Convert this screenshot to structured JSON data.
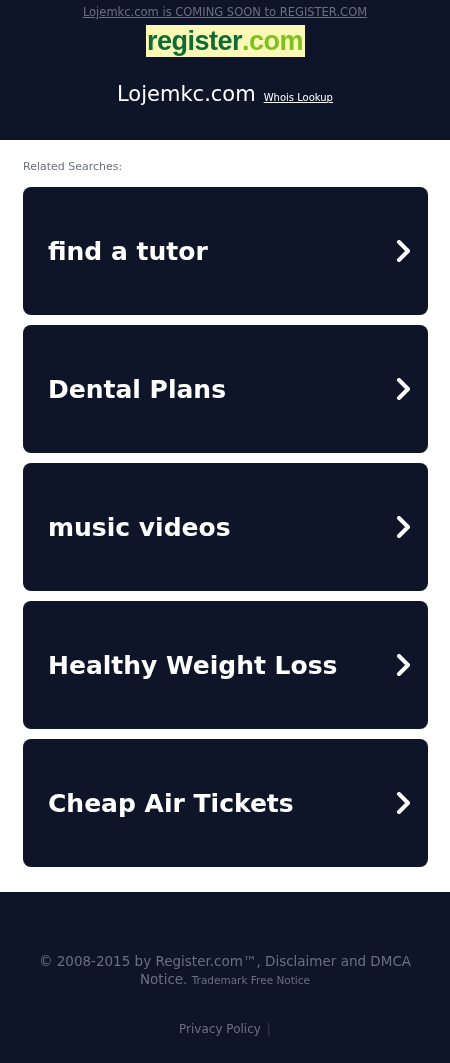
{
  "banner": {
    "text": "Lojemkc.com is COMING SOON to REGISTER.COM"
  },
  "logo": {
    "name": "register",
    "suffix": ".com"
  },
  "header": {
    "domain": "Lojemkc.com",
    "whois_link": "Whois Lookup"
  },
  "related": {
    "title": "Related Searches:",
    "items": [
      {
        "label": "find a tutor"
      },
      {
        "label": "Dental Plans"
      },
      {
        "label": "music videos"
      },
      {
        "label": "Healthy Weight Loss"
      },
      {
        "label": "Cheap Air Tickets"
      }
    ]
  },
  "footer": {
    "copyright": "© 2008-2015 by Register.com™, Disclaimer and DMCA Notice.",
    "trademark_link": "Trademark Free Notice",
    "privacy_link": "Privacy Policy",
    "separator": "|"
  }
}
